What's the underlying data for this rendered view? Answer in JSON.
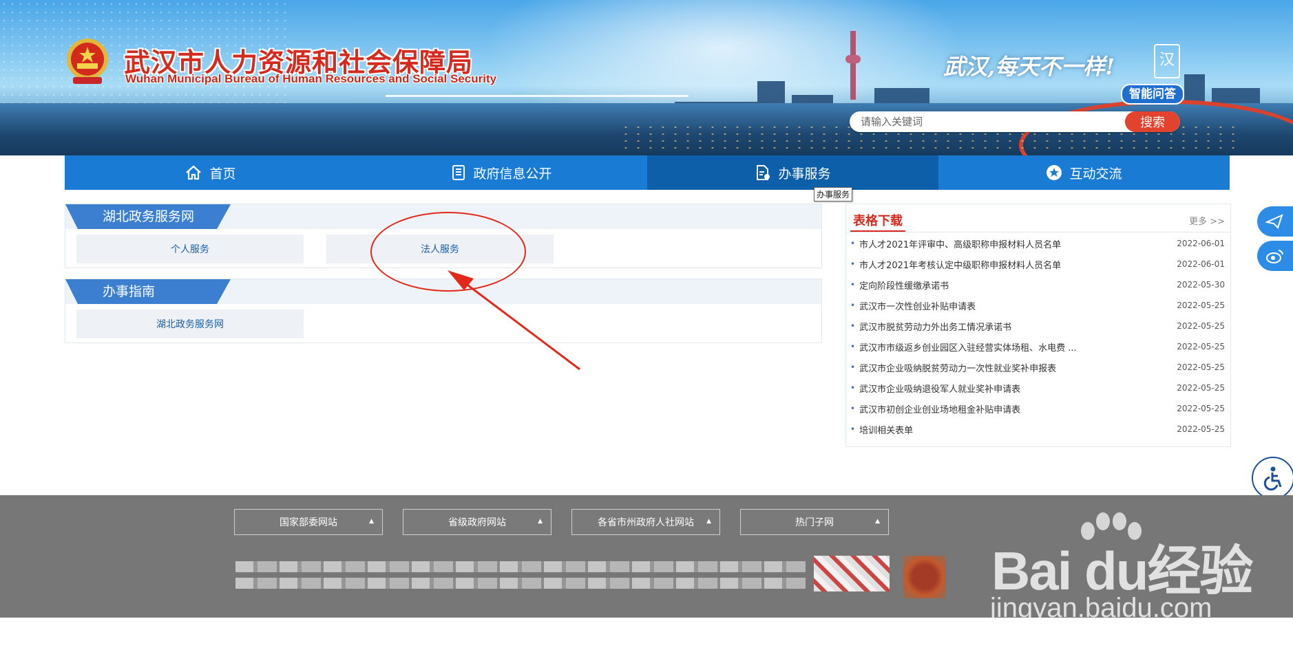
{
  "header": {
    "title_cn": "武汉市人力资源和社会保障局",
    "title_en": "Wuhan Municipal Bureau of Human Resources and Social Security",
    "slogan": "武汉,每天不一样!",
    "slogan_logo_text": "汉",
    "ai_qa_label": "智能问答",
    "search_placeholder": "请输入关键词",
    "search_button": "搜索"
  },
  "nav": {
    "items": [
      {
        "label": "首页",
        "icon": "home-icon"
      },
      {
        "label": "政府信息公开",
        "icon": "book-icon"
      },
      {
        "label": "办事服务",
        "icon": "document-icon"
      },
      {
        "label": "互动交流",
        "icon": "star-icon"
      }
    ],
    "active_index": 2,
    "tooltip": "办事服务"
  },
  "panels": [
    {
      "title": "湖北政务服务网",
      "buttons": [
        "个人服务",
        "法人服务"
      ]
    },
    {
      "title": "办事指南",
      "buttons": [
        "湖北政务服务网"
      ]
    }
  ],
  "downloads": {
    "title": "表格下载",
    "more": "更多 >>",
    "items": [
      {
        "name": "市人才2021年评审中、高级职称申报材料人员名单",
        "date": "2022-06-01"
      },
      {
        "name": "市人才2021年考核认定中级职称申报材料人员名单",
        "date": "2022-06-01"
      },
      {
        "name": "定向阶段性缓缴承诺书",
        "date": "2022-05-30"
      },
      {
        "name": "武汉市一次性创业补贴申请表",
        "date": "2022-05-25"
      },
      {
        "name": "武汉市脱贫劳动力外出务工情况承诺书",
        "date": "2022-05-25"
      },
      {
        "name": "武汉市市级返乡创业园区入驻经营实体场租、水电费 ...",
        "date": "2022-05-25"
      },
      {
        "name": "武汉市企业吸纳脱贫劳动力一次性就业奖补申报表",
        "date": "2022-05-25"
      },
      {
        "name": "武汉市企业吸纳退役军人就业奖补申请表",
        "date": "2022-05-25"
      },
      {
        "name": "武汉市初创企业创业场地租金补贴申请表",
        "date": "2022-05-25"
      },
      {
        "name": "培训相关表单",
        "date": "2022-05-25"
      }
    ]
  },
  "footer": {
    "selects": [
      "国家部委网站",
      "省级政府网站",
      "各省市州政府人社网站",
      "热门子网"
    ]
  },
  "watermark": {
    "main": "Bai du经验",
    "sub": "jingyan.baidu.com"
  },
  "colors": {
    "nav_blue": "#1a7bd4",
    "nav_active": "#0d5fa9",
    "title_red": "#d42b1e",
    "search_button": "#e2432f",
    "annotation_red": "#e12a1c",
    "footer_gray": "#777777"
  }
}
